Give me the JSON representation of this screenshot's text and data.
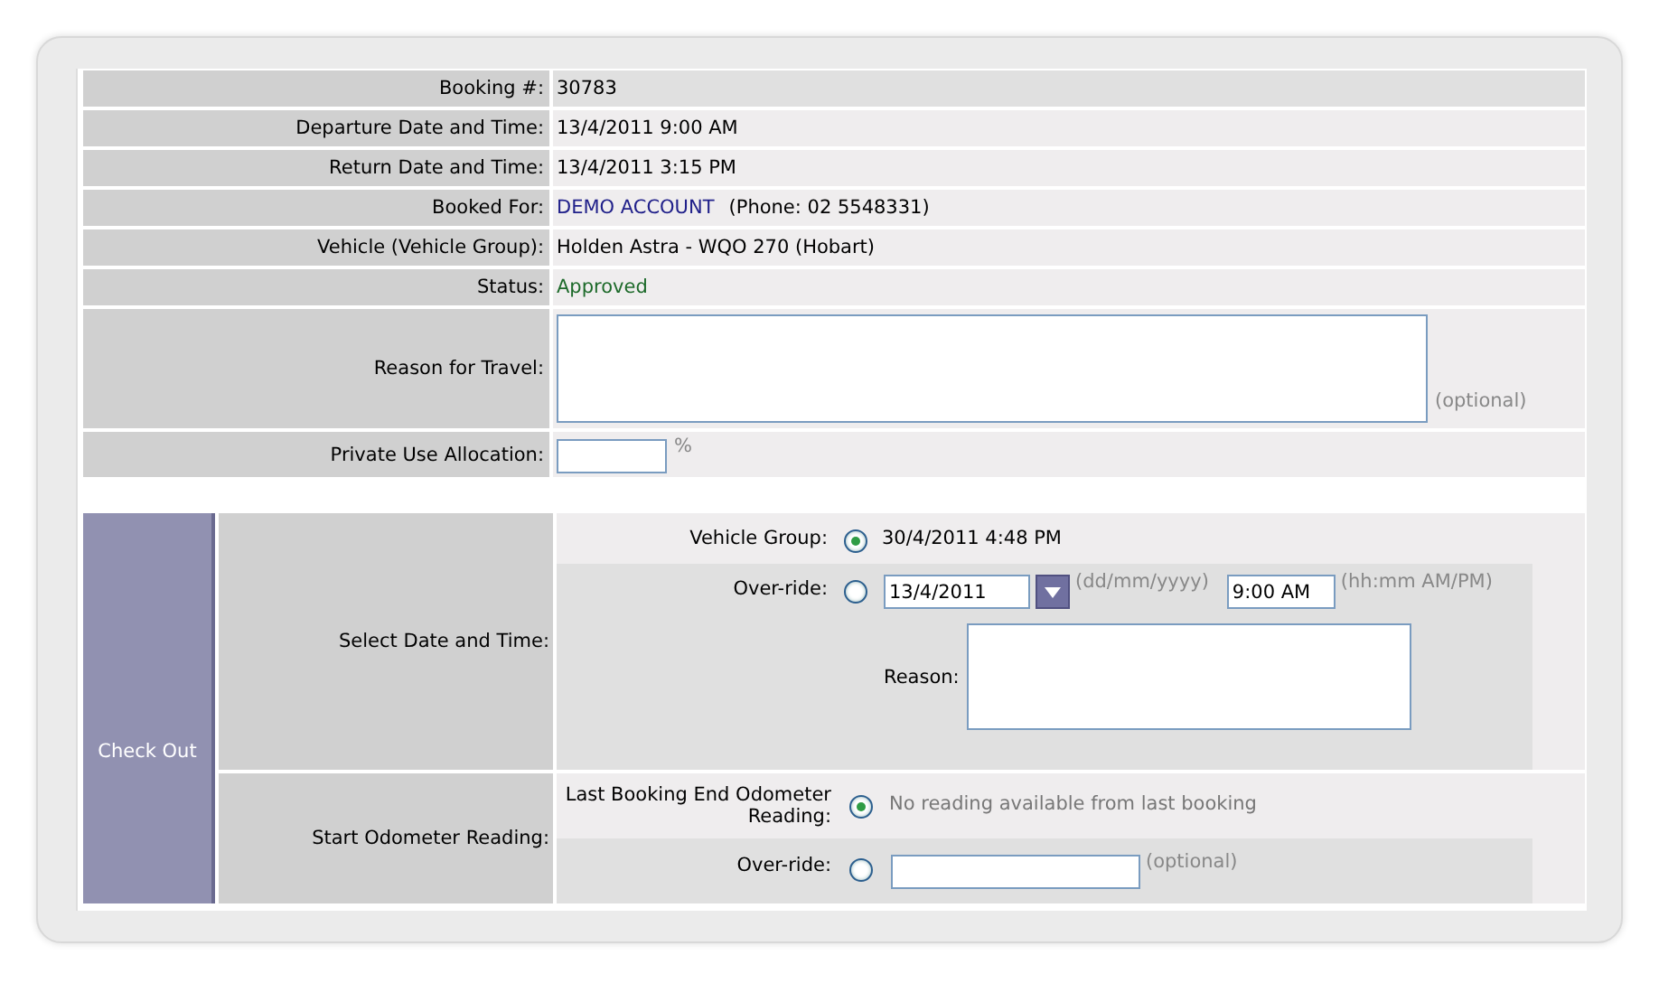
{
  "booking_details": [
    {
      "label": "Booking #:",
      "kind": "text",
      "value": "30783"
    },
    {
      "label": "Departure Date and Time:",
      "kind": "text",
      "value": "13/4/2011 9:00 AM"
    },
    {
      "label": "Return Date and Time:",
      "kind": "text",
      "value": "13/4/2011 3:15 PM"
    },
    {
      "label": "Booked For:",
      "kind": "link",
      "link": "DEMO ACCOUNT",
      "value": "(Phone: 02 5548331)"
    },
    {
      "label": "Vehicle (Vehicle Group):",
      "kind": "text",
      "value": "Holden Astra - WQO 270 (Hobart)"
    },
    {
      "label": "Status:",
      "kind": "status",
      "value": "Approved"
    },
    {
      "label": "Reason for Travel:",
      "kind": "textarea",
      "hint": "(optional)"
    },
    {
      "label": "Private Use Allocation:",
      "kind": "percent",
      "unit": "%"
    }
  ],
  "check_out": {
    "title": "Check Out",
    "sections": [
      {
        "label": "Select Date and Time:",
        "options": [
          {
            "label": "Vehicle Group:",
            "selected": true,
            "kind": "value",
            "value": "30/4/2011 4:48 PM"
          },
          {
            "label": "Over-ride:",
            "selected": false,
            "kind": "datetime",
            "date": "13/4/2011",
            "date_hint": "(dd/mm/yyyy)",
            "time": "9:00 AM",
            "time_hint": "(hh:mm AM/PM)",
            "reason_label": "Reason:"
          }
        ]
      },
      {
        "label": "Start Odometer Reading:",
        "options": [
          {
            "label": "Last Booking End Odometer Reading:",
            "selected": true,
            "kind": "note",
            "value": "No reading available from last booking"
          },
          {
            "label": "Over-ride:",
            "selected": false,
            "kind": "input",
            "hint": "(optional)"
          }
        ]
      }
    ]
  }
}
